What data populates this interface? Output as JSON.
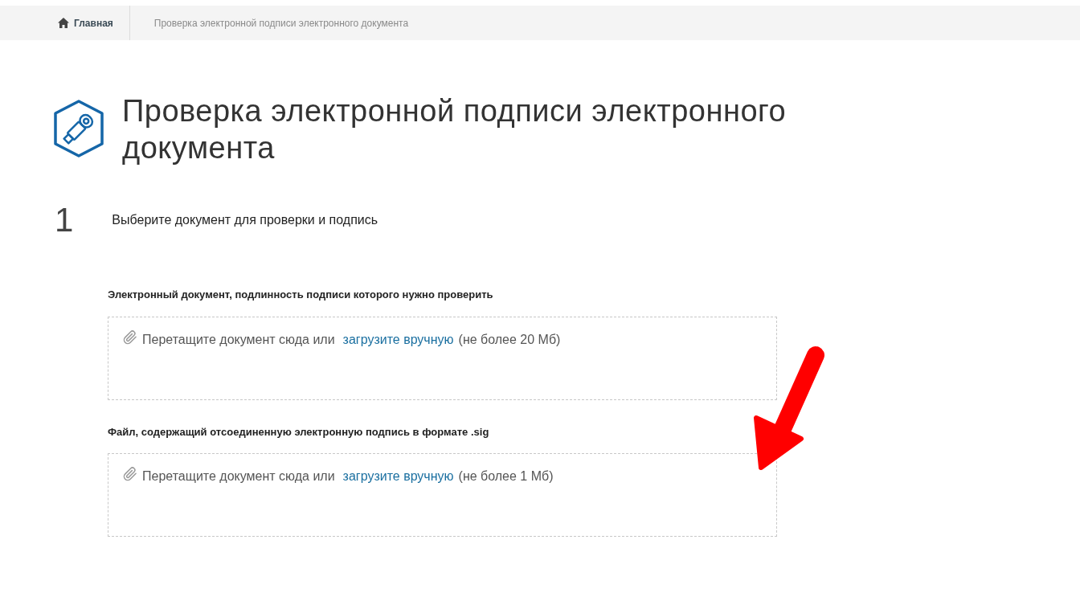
{
  "breadcrumbs": [
    {
      "label": "Главная",
      "kind": "home"
    },
    {
      "label": "Проверка электронной подписи электронного документа",
      "kind": "current"
    }
  ],
  "title": "Проверка электронной подписи электронного документа",
  "step": {
    "number": "1",
    "text": "Выберите документ для проверки и подпись"
  },
  "uploads": [
    {
      "label": "Электронный документ, подлинность подписи которого нужно проверить",
      "prompt": "Перетащите документ сюда или",
      "link": "загрузите вручную",
      "limit": "(не более 20 Мб)"
    },
    {
      "label": "Файл, содержащий отсоединенную электронную подпись в формате .sig",
      "prompt": "Перетащите документ сюда или",
      "link": "загрузите вручную",
      "limit": "(не более 1 Мб)"
    }
  ]
}
